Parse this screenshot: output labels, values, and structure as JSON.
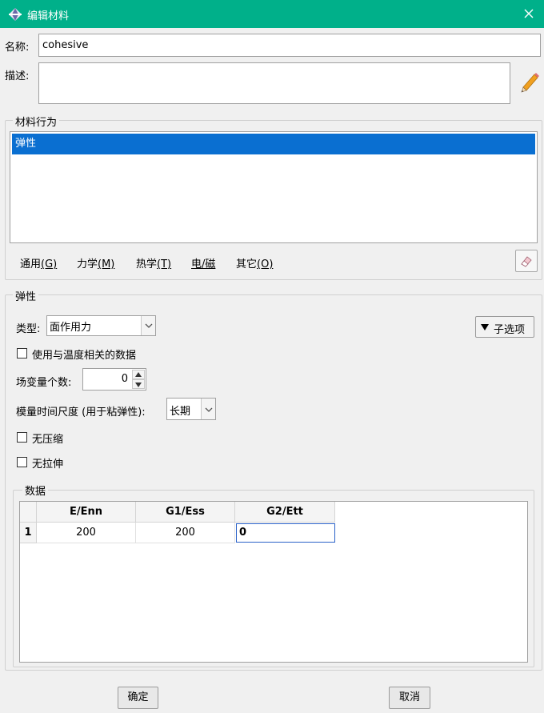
{
  "window": {
    "title": "编辑材料",
    "icons": {
      "app": "diamond-app-icon",
      "close": "close-icon"
    },
    "accent_color": "#00b08a"
  },
  "form": {
    "name_label": "名称:",
    "name_value": "cohesive",
    "desc_label": "描述:",
    "desc_value": ""
  },
  "behaviors": {
    "group_title": "材料行为",
    "items": [
      "弹性"
    ],
    "selected": "弹性",
    "menus": [
      {
        "label": "通用",
        "key": "(G)"
      },
      {
        "label": "力学",
        "key": "(M)"
      },
      {
        "label": "热学",
        "key": "(T)"
      },
      {
        "label": "电/磁",
        "key": ""
      },
      {
        "label": "其它",
        "key": "(O)"
      }
    ]
  },
  "elastic": {
    "group_title": "弹性",
    "type_label": "类型:",
    "type_value": "面作用力",
    "suboptions_label": "子选项",
    "temp_dependent_label": "使用与温度相关的数据",
    "temp_dependent_checked": false,
    "field_vars_label": "场变量个数:",
    "field_vars_value": "0",
    "timescale_label": "模量时间尺度 (用于粘弹性):",
    "timescale_value": "长期",
    "no_compression_label": "无压缩",
    "no_compression_checked": false,
    "no_tension_label": "无拉伸",
    "no_tension_checked": false
  },
  "data_table": {
    "group_title": "数据",
    "columns": [
      "E/Enn",
      "G1/Ess",
      "G2/Ett"
    ],
    "rows": [
      {
        "index": "1",
        "cells": [
          "200",
          "200",
          "0"
        ]
      }
    ]
  },
  "footer": {
    "ok_label": "确定",
    "cancel_label": "取消"
  }
}
